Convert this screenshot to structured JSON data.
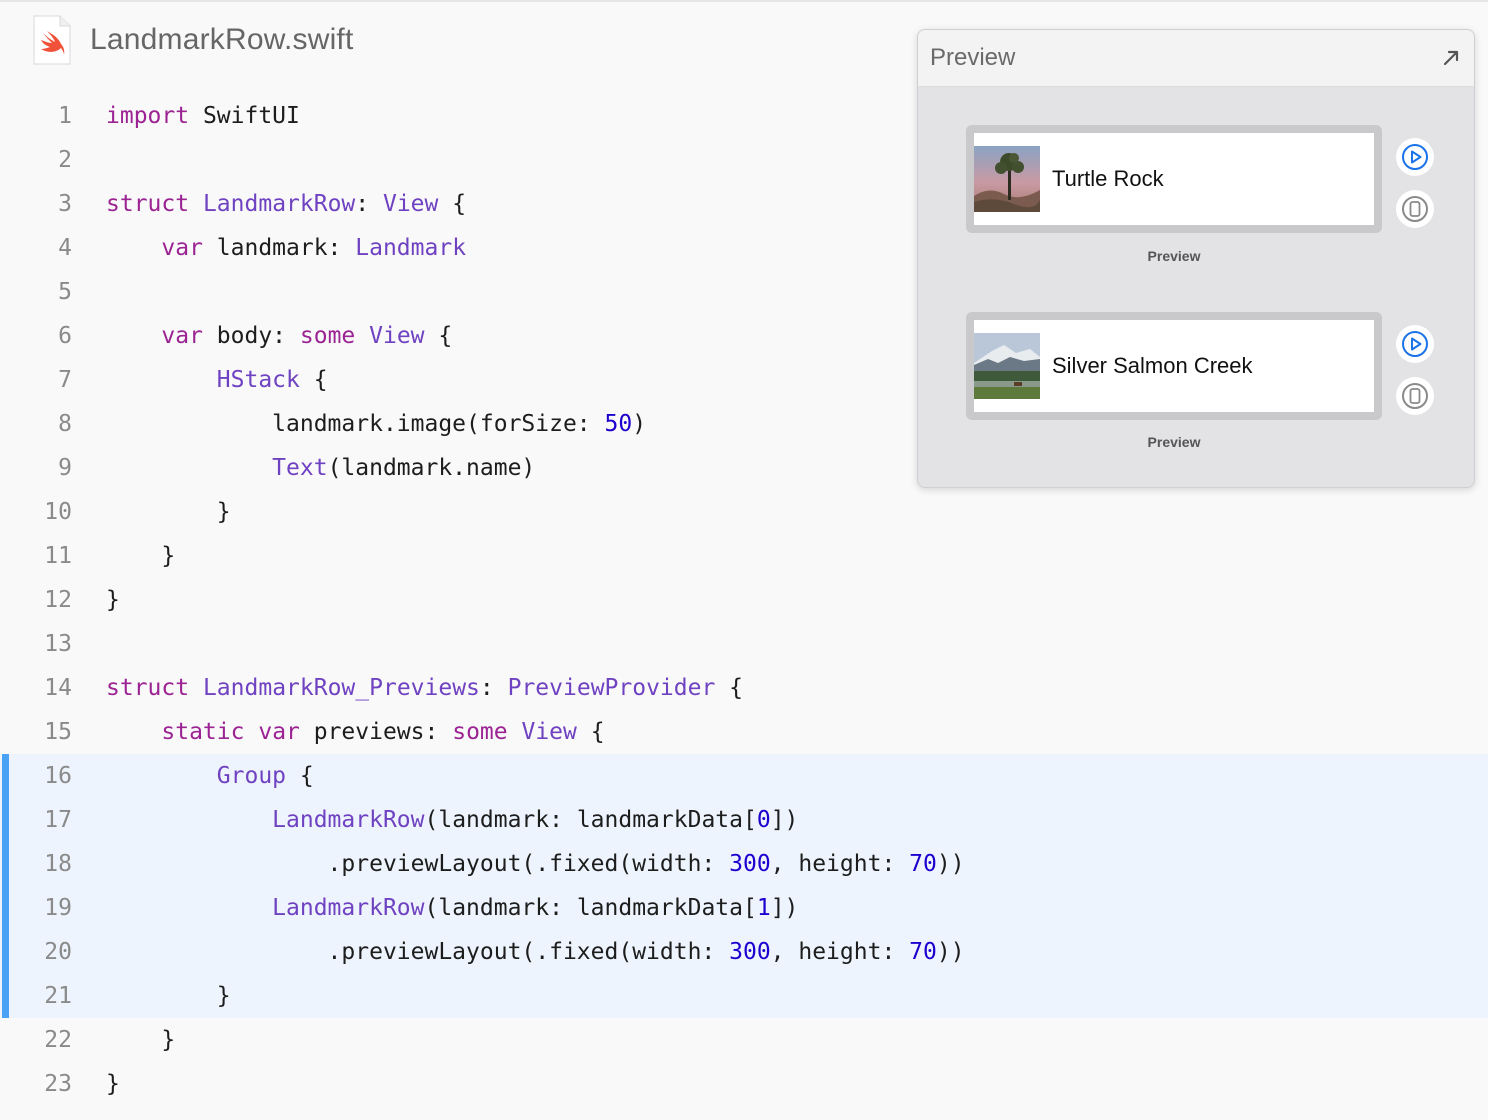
{
  "file": {
    "name": "LandmarkRow.swift",
    "icon": "swift-file-icon"
  },
  "code": {
    "lines": [
      {
        "n": "1",
        "parts": [
          [
            "kw",
            "import"
          ],
          [
            "pl",
            " SwiftUI"
          ]
        ]
      },
      {
        "n": "2",
        "parts": []
      },
      {
        "n": "3",
        "parts": [
          [
            "kw",
            "struct"
          ],
          [
            "pl",
            " "
          ],
          [
            "ty",
            "LandmarkRow"
          ],
          [
            "pl",
            ": "
          ],
          [
            "ty",
            "View"
          ],
          [
            "pl",
            " {"
          ]
        ]
      },
      {
        "n": "4",
        "parts": [
          [
            "pl",
            "    "
          ],
          [
            "kw",
            "var"
          ],
          [
            "pl",
            " landmark: "
          ],
          [
            "ty",
            "Landmark"
          ]
        ]
      },
      {
        "n": "5",
        "parts": []
      },
      {
        "n": "6",
        "parts": [
          [
            "pl",
            "    "
          ],
          [
            "kw",
            "var"
          ],
          [
            "pl",
            " body: "
          ],
          [
            "kw",
            "some"
          ],
          [
            "pl",
            " "
          ],
          [
            "ty",
            "View"
          ],
          [
            "pl",
            " {"
          ]
        ]
      },
      {
        "n": "7",
        "parts": [
          [
            "pl",
            "        "
          ],
          [
            "ty",
            "HStack"
          ],
          [
            "pl",
            " {"
          ]
        ]
      },
      {
        "n": "8",
        "parts": [
          [
            "pl",
            "            landmark.image(forSize: "
          ],
          [
            "nm",
            "50"
          ],
          [
            "pl",
            ")"
          ]
        ]
      },
      {
        "n": "9",
        "parts": [
          [
            "pl",
            "            "
          ],
          [
            "ty",
            "Text"
          ],
          [
            "pl",
            "(landmark.name)"
          ]
        ]
      },
      {
        "n": "10",
        "parts": [
          [
            "pl",
            "        }"
          ]
        ]
      },
      {
        "n": "11",
        "parts": [
          [
            "pl",
            "    }"
          ]
        ]
      },
      {
        "n": "12",
        "parts": [
          [
            "pl",
            "}"
          ]
        ]
      },
      {
        "n": "13",
        "parts": []
      },
      {
        "n": "14",
        "parts": [
          [
            "kw",
            "struct"
          ],
          [
            "pl",
            " "
          ],
          [
            "ty",
            "LandmarkRow_Previews"
          ],
          [
            "pl",
            ": "
          ],
          [
            "ty",
            "PreviewProvider"
          ],
          [
            "pl",
            " {"
          ]
        ]
      },
      {
        "n": "15",
        "parts": [
          [
            "pl",
            "    "
          ],
          [
            "kw",
            "static"
          ],
          [
            "pl",
            " "
          ],
          [
            "kw",
            "var"
          ],
          [
            "pl",
            " previews: "
          ],
          [
            "kw",
            "some"
          ],
          [
            "pl",
            " "
          ],
          [
            "ty",
            "View"
          ],
          [
            "pl",
            " {"
          ]
        ]
      },
      {
        "n": "16",
        "hl": true,
        "parts": [
          [
            "pl",
            "        "
          ],
          [
            "ty",
            "Group"
          ],
          [
            "pl",
            " {"
          ]
        ]
      },
      {
        "n": "17",
        "hl": true,
        "parts": [
          [
            "pl",
            "            "
          ],
          [
            "ty",
            "LandmarkRow"
          ],
          [
            "pl",
            "(landmark: landmarkData["
          ],
          [
            "nm",
            "0"
          ],
          [
            "pl",
            "])"
          ]
        ]
      },
      {
        "n": "18",
        "hl": true,
        "parts": [
          [
            "pl",
            "                .previewLayout(.fixed(width: "
          ],
          [
            "nm",
            "300"
          ],
          [
            "pl",
            ", height: "
          ],
          [
            "nm",
            "70"
          ],
          [
            "pl",
            "))"
          ]
        ]
      },
      {
        "n": "19",
        "hl": true,
        "parts": [
          [
            "pl",
            "            "
          ],
          [
            "ty",
            "LandmarkRow"
          ],
          [
            "pl",
            "(landmark: landmarkData["
          ],
          [
            "nm",
            "1"
          ],
          [
            "pl",
            "])"
          ]
        ]
      },
      {
        "n": "20",
        "hl": true,
        "parts": [
          [
            "pl",
            "                .previewLayout(.fixed(width: "
          ],
          [
            "nm",
            "300"
          ],
          [
            "pl",
            ", height: "
          ],
          [
            "nm",
            "70"
          ],
          [
            "pl",
            "))"
          ]
        ]
      },
      {
        "n": "21",
        "hl": true,
        "parts": [
          [
            "pl",
            "        }"
          ]
        ]
      },
      {
        "n": "22",
        "parts": [
          [
            "pl",
            "    }"
          ]
        ]
      },
      {
        "n": "23",
        "parts": [
          [
            "pl",
            "}"
          ]
        ]
      }
    ]
  },
  "preview": {
    "title": "Preview",
    "expand_icon": "expand-arrow-icon",
    "rows": [
      {
        "name": "Turtle Rock",
        "caption": "Preview"
      },
      {
        "name": "Silver Salmon Creek",
        "caption": "Preview"
      }
    ],
    "live_icon": "play-circle-icon",
    "device_icon": "device-icon"
  },
  "colors": {
    "keyword": "#9b2393",
    "type": "#6f42c1",
    "number": "#1c00cf",
    "highlight": "#edf4fd",
    "highlight_bar": "#4aa2f5",
    "accent": "#1a73e8"
  }
}
